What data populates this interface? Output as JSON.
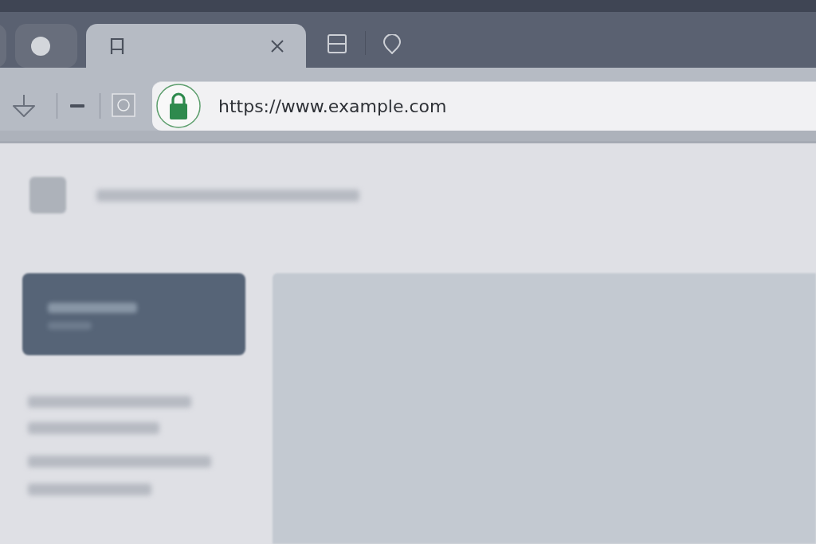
{
  "tabs": [
    {
      "selected": false
    },
    {
      "selected": false
    },
    {
      "selected": true
    }
  ],
  "address_bar": {
    "url": "https://www.example.com",
    "secure": true
  }
}
